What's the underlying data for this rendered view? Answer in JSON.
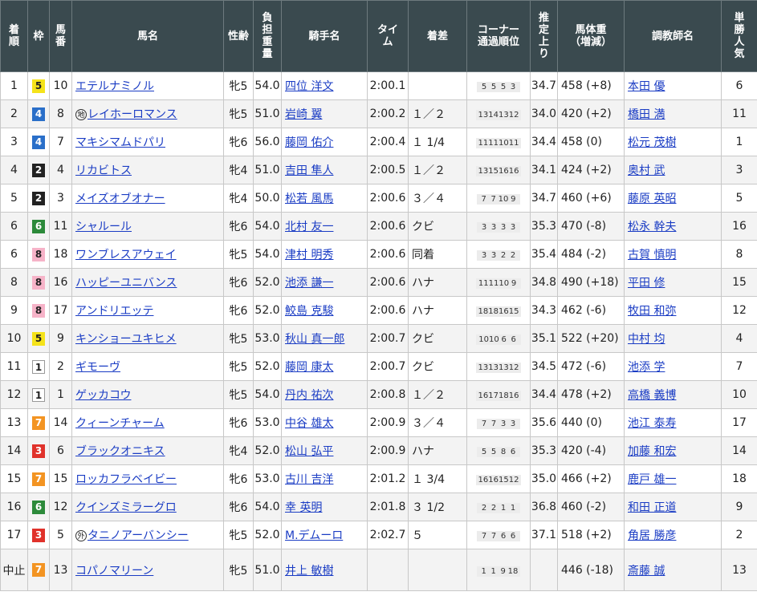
{
  "headers": {
    "rank": [
      "着",
      "順"
    ],
    "waku": [
      "枠"
    ],
    "umaban": [
      "馬",
      "番"
    ],
    "horse": [
      "馬名"
    ],
    "sexage": [
      "性齢"
    ],
    "weight": [
      "負",
      "担",
      "重",
      "量"
    ],
    "jockey": [
      "騎手名"
    ],
    "time": [
      "タイ",
      "ム"
    ],
    "margin": [
      "着差"
    ],
    "corner": [
      "コーナー",
      "通過順位"
    ],
    "last3f": [
      "推",
      "定",
      "上",
      "り"
    ],
    "body": [
      "馬体重",
      "（増減）"
    ],
    "trainer": [
      "調教師名"
    ],
    "pop": [
      "単",
      "勝",
      "人",
      "気"
    ]
  },
  "colors": {
    "waku1": "#ffffff",
    "waku2": "#222222",
    "waku3": "#e0322b",
    "waku4": "#2a6fc9",
    "waku5": "#f5e31a",
    "waku6": "#2c8a3a",
    "waku7": "#f39422",
    "waku8": "#f6b3c8",
    "link": "#1a3cc4",
    "header_bg": "#3a4a4f"
  },
  "rows": [
    {
      "rank": "1",
      "waku": "5",
      "umaban": "10",
      "sym": "",
      "horse": "エテルナミノル",
      "sexage": "牝5",
      "weight": "54.0",
      "jockey": "四位 洋文",
      "time": "2:00.1",
      "margin": "",
      "corner": [
        "5",
        "5",
        "5",
        "3"
      ],
      "last3f": "34.7",
      "body": "458 (+8)",
      "trainer": "本田 優",
      "pop": "6"
    },
    {
      "rank": "2",
      "waku": "4",
      "umaban": "8",
      "sym": "地",
      "horse": "レイホーロマンス",
      "sexage": "牝5",
      "weight": "51.0",
      "jockey": "岩崎 翼",
      "time": "2:00.2",
      "margin": "１／２",
      "corner": [
        "13",
        "14",
        "13",
        "12"
      ],
      "last3f": "34.0",
      "body": "420 (+2)",
      "trainer": "橋田 満",
      "pop": "11"
    },
    {
      "rank": "3",
      "waku": "4",
      "umaban": "7",
      "sym": "",
      "horse": "マキシマムドパリ",
      "sexage": "牝6",
      "weight": "56.0",
      "jockey": "藤岡 佑介",
      "time": "2:00.4",
      "margin": "１ 1/4",
      "corner": [
        "11",
        "11",
        "10",
        "11"
      ],
      "last3f": "34.4",
      "body": "458 (0)",
      "trainer": "松元 茂樹",
      "pop": "1"
    },
    {
      "rank": "4",
      "waku": "2",
      "umaban": "4",
      "sym": "",
      "horse": "リカビトス",
      "sexage": "牝4",
      "weight": "51.0",
      "jockey": "吉田 隼人",
      "time": "2:00.5",
      "margin": "１／２",
      "corner": [
        "13",
        "15",
        "16",
        "16"
      ],
      "last3f": "34.1",
      "body": "424 (+2)",
      "trainer": "奥村 武",
      "pop": "3"
    },
    {
      "rank": "5",
      "waku": "2",
      "umaban": "3",
      "sym": "",
      "horse": "メイズオブオナー",
      "sexage": "牝4",
      "weight": "50.0",
      "jockey": "松若 風馬",
      "time": "2:00.6",
      "margin": "３／４",
      "corner": [
        "7",
        "7",
        "10",
        "9"
      ],
      "last3f": "34.7",
      "body": "460 (+6)",
      "trainer": "藤原 英昭",
      "pop": "5"
    },
    {
      "rank": "6",
      "waku": "6",
      "umaban": "11",
      "sym": "",
      "horse": "シャルール",
      "sexage": "牝6",
      "weight": "54.0",
      "jockey": "北村 友一",
      "time": "2:00.6",
      "margin": "クビ",
      "corner": [
        "3",
        "3",
        "3",
        "3"
      ],
      "last3f": "35.3",
      "body": "470 (-8)",
      "trainer": "松永 幹夫",
      "pop": "16"
    },
    {
      "rank": "6",
      "waku": "8",
      "umaban": "18",
      "sym": "",
      "horse": "ワンブレスアウェイ",
      "sexage": "牝5",
      "weight": "54.0",
      "jockey": "津村 明秀",
      "time": "2:00.6",
      "margin": "同着",
      "corner": [
        "3",
        "3",
        "2",
        "2"
      ],
      "last3f": "35.4",
      "body": "484 (-2)",
      "trainer": "古賀 慎明",
      "pop": "8"
    },
    {
      "rank": "8",
      "waku": "8",
      "umaban": "16",
      "sym": "",
      "horse": "ハッピーユニバンス",
      "sexage": "牝6",
      "weight": "52.0",
      "jockey": "池添 謙一",
      "time": "2:00.6",
      "margin": "ハナ",
      "corner": [
        "11",
        "11",
        "10",
        "9"
      ],
      "last3f": "34.8",
      "body": "490 (+18)",
      "trainer": "平田 修",
      "pop": "15"
    },
    {
      "rank": "9",
      "waku": "8",
      "umaban": "17",
      "sym": "",
      "horse": "アンドリエッテ",
      "sexage": "牝6",
      "weight": "52.0",
      "jockey": "鮫島 克駿",
      "time": "2:00.6",
      "margin": "ハナ",
      "corner": [
        "18",
        "18",
        "16",
        "15"
      ],
      "last3f": "34.3",
      "body": "462 (-6)",
      "trainer": "牧田 和弥",
      "pop": "12"
    },
    {
      "rank": "10",
      "waku": "5",
      "umaban": "9",
      "sym": "",
      "horse": "キンショーユキヒメ",
      "sexage": "牝5",
      "weight": "53.0",
      "jockey": "秋山 真一郎",
      "time": "2:00.7",
      "margin": "クビ",
      "corner": [
        "10",
        "10",
        "6",
        "6"
      ],
      "last3f": "35.1",
      "body": "522 (+20)",
      "trainer": "中村 均",
      "pop": "4"
    },
    {
      "rank": "11",
      "waku": "1",
      "umaban": "2",
      "sym": "",
      "horse": "ギモーヴ",
      "sexage": "牝5",
      "weight": "52.0",
      "jockey": "藤岡 康太",
      "time": "2:00.7",
      "margin": "クビ",
      "corner": [
        "13",
        "13",
        "13",
        "12"
      ],
      "last3f": "34.5",
      "body": "472 (-6)",
      "trainer": "池添 学",
      "pop": "7"
    },
    {
      "rank": "12",
      "waku": "1",
      "umaban": "1",
      "sym": "",
      "horse": "ゲッカコウ",
      "sexage": "牝5",
      "weight": "54.0",
      "jockey": "丹内 祐次",
      "time": "2:00.8",
      "margin": "１／２",
      "corner": [
        "16",
        "17",
        "18",
        "16"
      ],
      "last3f": "34.4",
      "body": "478 (+2)",
      "trainer": "高橋 義博",
      "pop": "10"
    },
    {
      "rank": "13",
      "waku": "7",
      "umaban": "14",
      "sym": "",
      "horse": "クィーンチャーム",
      "sexage": "牝6",
      "weight": "53.0",
      "jockey": "中谷 雄太",
      "time": "2:00.9",
      "margin": "３／４",
      "corner": [
        "7",
        "7",
        "3",
        "3"
      ],
      "last3f": "35.6",
      "body": "440 (0)",
      "trainer": "池江 泰寿",
      "pop": "17"
    },
    {
      "rank": "14",
      "waku": "3",
      "umaban": "6",
      "sym": "",
      "horse": "ブラックオニキス",
      "sexage": "牝4",
      "weight": "52.0",
      "jockey": "松山 弘平",
      "time": "2:00.9",
      "margin": "ハナ",
      "corner": [
        "5",
        "5",
        "8",
        "6"
      ],
      "last3f": "35.3",
      "body": "420 (-4)",
      "trainer": "加藤 和宏",
      "pop": "14"
    },
    {
      "rank": "15",
      "waku": "7",
      "umaban": "15",
      "sym": "",
      "horse": "ロッカフラベイビー",
      "sexage": "牝6",
      "weight": "53.0",
      "jockey": "古川 吉洋",
      "time": "2:01.2",
      "margin": "１ 3/4",
      "corner": [
        "16",
        "16",
        "15",
        "12"
      ],
      "last3f": "35.0",
      "body": "466 (+2)",
      "trainer": "鹿戸 雄一",
      "pop": "18"
    },
    {
      "rank": "16",
      "waku": "6",
      "umaban": "12",
      "sym": "",
      "horse": "クインズミラーグロ",
      "sexage": "牝6",
      "weight": "54.0",
      "jockey": "幸 英明",
      "time": "2:01.8",
      "margin": "３ 1/2",
      "corner": [
        "2",
        "2",
        "1",
        "1"
      ],
      "last3f": "36.8",
      "body": "460 (-2)",
      "trainer": "和田 正道",
      "pop": "9"
    },
    {
      "rank": "17",
      "waku": "3",
      "umaban": "5",
      "sym": "外",
      "horse": "タニノアーバンシー",
      "sexage": "牝5",
      "weight": "52.0",
      "jockey": "M.デムーロ",
      "time": "2:02.7",
      "margin": "５",
      "corner": [
        "7",
        "7",
        "6",
        "6"
      ],
      "last3f": "37.1",
      "body": "518 (+2)",
      "trainer": "角居 勝彦",
      "pop": "2"
    },
    {
      "rank": "中止",
      "waku": "7",
      "umaban": "13",
      "sym": "",
      "horse": "コパノマリーン",
      "sexage": "牝5",
      "weight": "51.0",
      "jockey": "井上 敏樹",
      "time": "",
      "margin": "",
      "corner": [
        "1",
        "1",
        "9",
        "18"
      ],
      "last3f": "",
      "body": "446 (-18)",
      "trainer": "斎藤 誠",
      "pop": "13"
    }
  ]
}
